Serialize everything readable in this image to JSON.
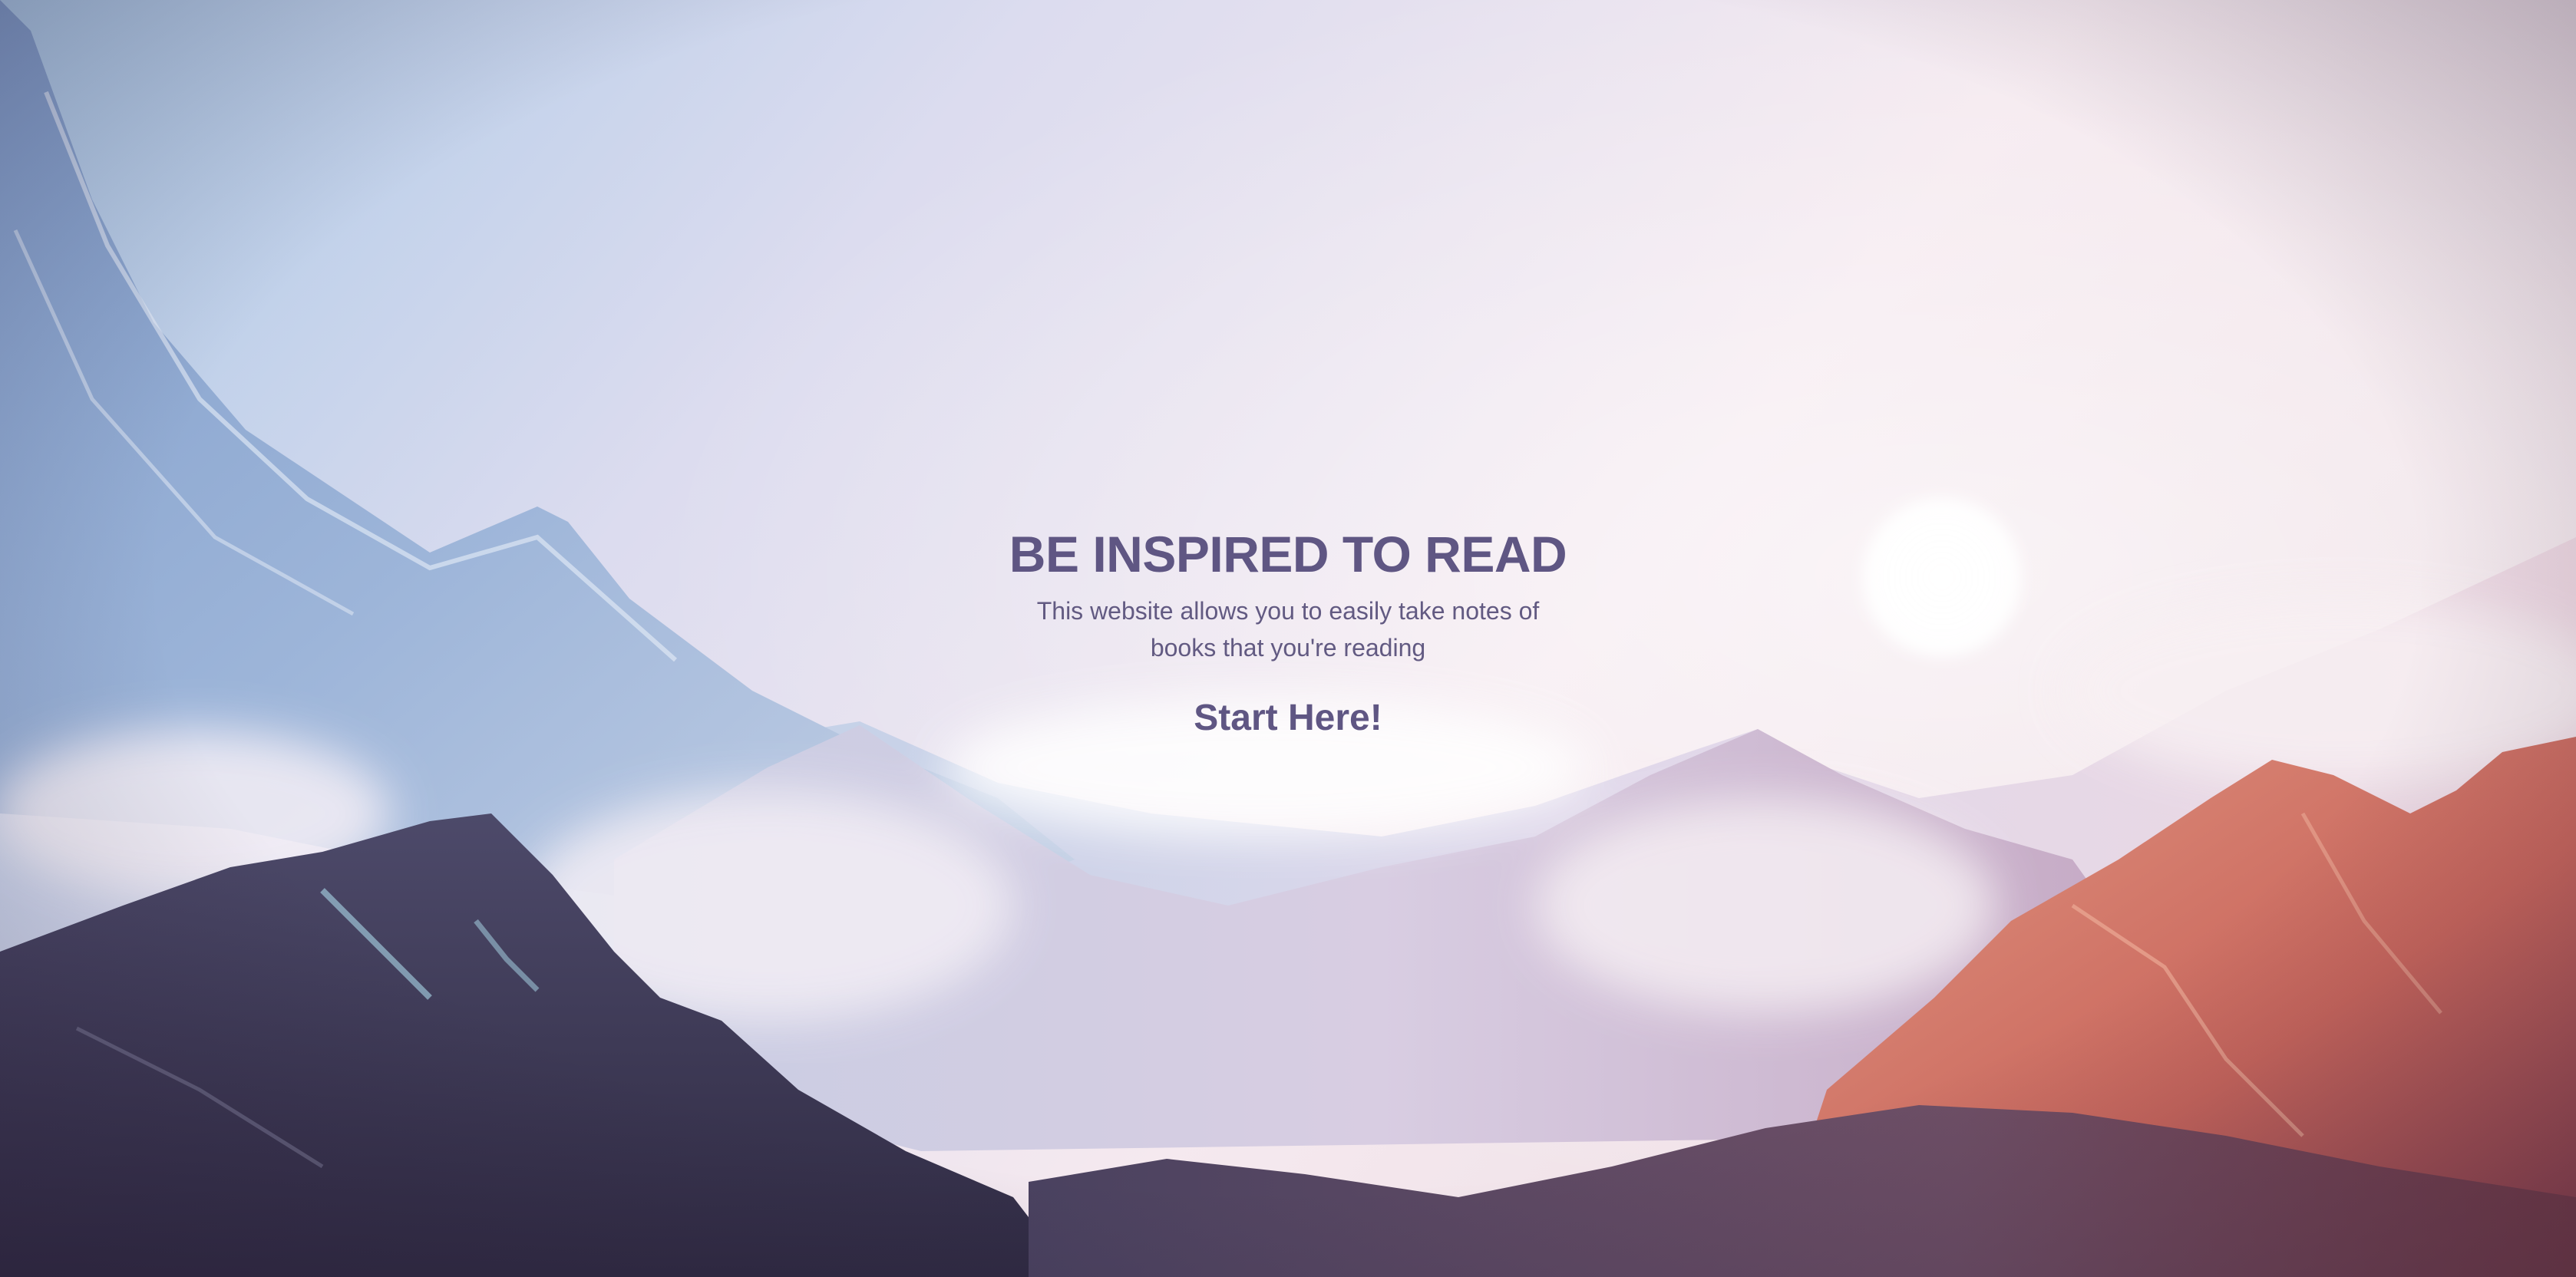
{
  "hero": {
    "title": "BE INSPIRED TO READ",
    "subtitle": "This website allows you to easily take notes of books that you're reading",
    "cta_label": "Start Here!",
    "background_image": "mountain-landscape-sunrise"
  },
  "colors": {
    "text": "#5f5683",
    "sky_left": "#aecbe6",
    "sky_right": "#f6e9ee",
    "mountain_dark": "#3a3550",
    "mountain_orange": "#d9826e"
  }
}
